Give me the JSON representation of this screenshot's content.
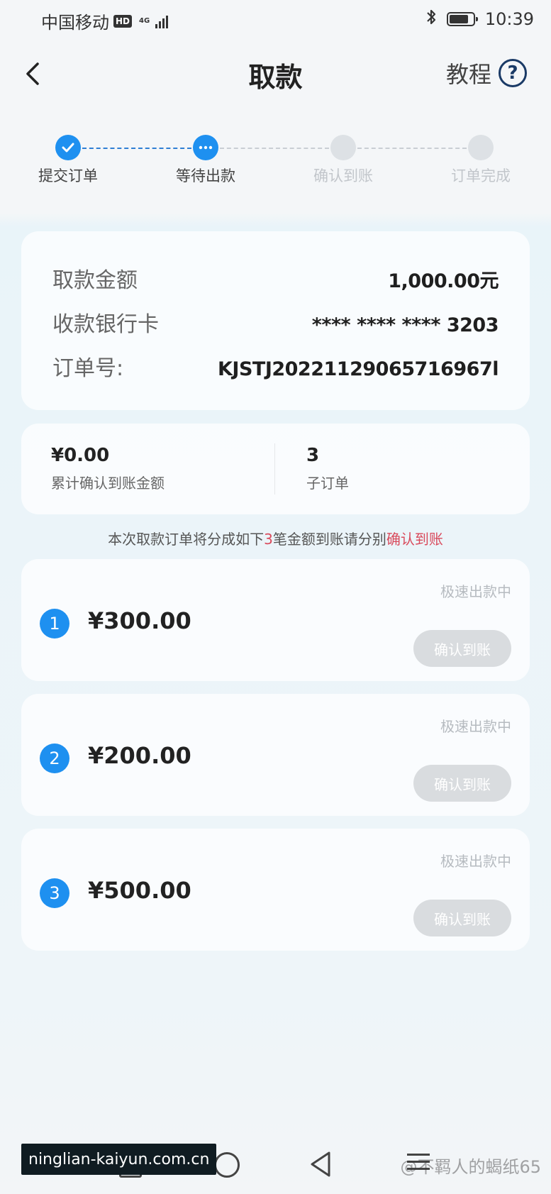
{
  "status_bar": {
    "carrier": "中国移动",
    "hd": "HD",
    "network": "4G",
    "time": "10:39",
    "battery_level": 0.85
  },
  "header": {
    "title": "取款",
    "tutorial_label": "教程",
    "help_glyph": "?"
  },
  "steps": [
    {
      "label": "提交订单",
      "state": "done"
    },
    {
      "label": "等待出款",
      "state": "current"
    },
    {
      "label": "确认到账",
      "state": "pending"
    },
    {
      "label": "订单完成",
      "state": "pending"
    }
  ],
  "info": {
    "amount_label": "取款金额",
    "amount_value": "1,000.00元",
    "card_label": "收款银行卡",
    "card_value": "**** **** **** 3203",
    "order_label": "订单号:",
    "order_value": "KJSTJ20221129065716967l"
  },
  "summary": {
    "confirmed_amount": "¥0.00",
    "confirmed_label": "累计确认到账金额",
    "suborder_count": "3",
    "suborder_label": "子订单"
  },
  "notice": {
    "prefix": "本次取款订单将分成如下",
    "count": "3",
    "middle": "笔金额到账请分别",
    "action": "确认到账"
  },
  "orders": [
    {
      "index": "1",
      "amount": "¥300.00",
      "status": "极速出款中",
      "button": "确认到账"
    },
    {
      "index": "2",
      "amount": "¥200.00",
      "status": "极速出款中",
      "button": "确认到账"
    },
    {
      "index": "3",
      "amount": "¥500.00",
      "status": "极速出款中",
      "button": "确认到账"
    }
  ],
  "watermarks": {
    "left": "ninglian-kaiyun.com.cn",
    "right": "@不羁人的蝎纸65"
  },
  "colors": {
    "accent": "#1e90f0",
    "highlight": "#d94a5c",
    "disabled_button": "#d9dcdf"
  },
  "icons": [
    "back-arrow-icon",
    "help-icon",
    "check-icon",
    "more-dots-icon",
    "bluetooth-icon",
    "battery-icon",
    "signal-icon"
  ]
}
